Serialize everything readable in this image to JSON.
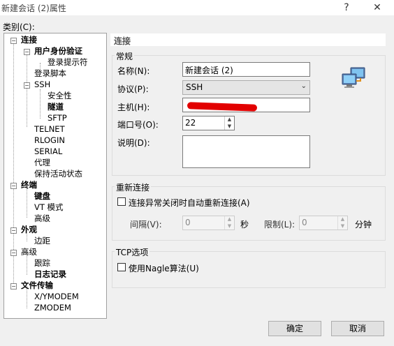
{
  "window": {
    "title": "新建会话 (2)属性",
    "help_label": "?",
    "close_label": "✕"
  },
  "category_label": "类别(C):",
  "tree": {
    "connection": "连接",
    "user_auth": "用户身份验证",
    "login_prompt": "登录提示符",
    "login_script": "登录脚本",
    "ssh": "SSH",
    "security": "安全性",
    "tunnel": "隧道",
    "sftp": "SFTP",
    "telnet": "TELNET",
    "rlogin": "RLOGIN",
    "serial": "SERIAL",
    "proxy": "代理",
    "keepalive": "保持活动状态",
    "terminal": "终端",
    "keyboard": "键盘",
    "vt_mode": "VT 模式",
    "advanced1": "高级",
    "appearance": "外观",
    "margin": "边距",
    "advanced2": "高级",
    "trace": "跟踪",
    "log": "日志记录",
    "file_transfer": "文件传输",
    "xymodem": "X/YMODEM",
    "zmodem": "ZMODEM"
  },
  "panel": {
    "header": "连接",
    "general": {
      "label": "常规",
      "name_label": "名称(N):",
      "name_value": "新建会话 (2)",
      "protocol_label": "协议(P):",
      "protocol_value": "SSH",
      "host_label": "主机(H):",
      "host_value": "",
      "port_label": "端口号(O):",
      "port_value": "22",
      "desc_label": "说明(D):",
      "desc_value": ""
    },
    "reconnect": {
      "label": "重新连接",
      "checkbox_label": "连接异常关闭时自动重新连接(A)",
      "interval_label": "间隔(V):",
      "interval_value": "0",
      "sec_unit": "秒",
      "limit_label": "限制(L):",
      "limit_value": "0",
      "min_unit": "分钟"
    },
    "tcp": {
      "label": "TCP选项",
      "nagle_label": "使用Nagle算法(U)"
    }
  },
  "buttons": {
    "ok": "确定",
    "cancel": "取消"
  }
}
